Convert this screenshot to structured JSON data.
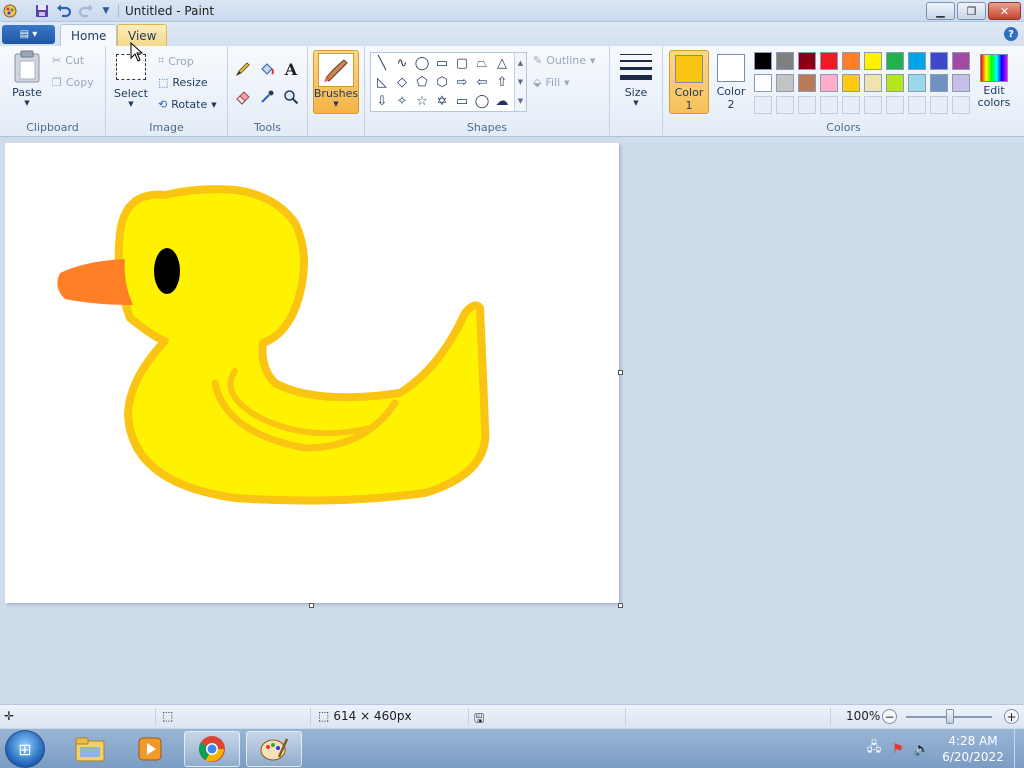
{
  "app": {
    "window_title": "Untitled - Paint"
  },
  "quick_access": {
    "icons": [
      "paint-app-icon",
      "save-icon",
      "undo-icon",
      "redo-icon",
      "customize-qat-icon"
    ]
  },
  "tabs": {
    "home": "Home",
    "view": "View"
  },
  "ribbon": {
    "clipboard": {
      "label": "Clipboard",
      "paste": "Paste",
      "cut": "Cut",
      "copy": "Copy"
    },
    "image": {
      "label": "Image",
      "select": "Select",
      "crop": "Crop",
      "resize": "Resize",
      "rotate": "Rotate"
    },
    "tools": {
      "label": "Tools"
    },
    "brushes": {
      "label": "Brushes"
    },
    "shapes": {
      "label": "Shapes",
      "outline": "Outline",
      "fill": "Fill"
    },
    "size": {
      "label": "Size"
    },
    "colors": {
      "label": "Colors",
      "color1_line1": "Color",
      "color1_line2": "1",
      "color2_line1": "Color",
      "color2_line2": "2",
      "edit_line1": "Edit",
      "edit_line2": "colors",
      "color1_value": "#f9c512",
      "color2_value": "#ffffff",
      "palette_row1": [
        "#000000",
        "#7f7f7f",
        "#880015",
        "#ed1c24",
        "#ff7f27",
        "#fff200",
        "#22b14c",
        "#00a2e8",
        "#3f48cc",
        "#a349a4"
      ],
      "palette_row2": [
        "#ffffff",
        "#c3c3c3",
        "#b97a57",
        "#ffaec9",
        "#ffc90e",
        "#efe4b0",
        "#b5e61d",
        "#99d9ea",
        "#7092be",
        "#c8bfe7"
      ]
    }
  },
  "canvas": {
    "background": "#ffffff",
    "drawing": {
      "body_fill": "#fff200",
      "outline": "#f9c512",
      "beak": "#ff7f27",
      "eye": "#000000"
    }
  },
  "statusbar": {
    "dimensions": "614 × 460px",
    "zoom": "100%",
    "zoom_level": 1.0
  },
  "taskbar": {
    "time": "4:28 AM",
    "date": "6/20/2022"
  }
}
